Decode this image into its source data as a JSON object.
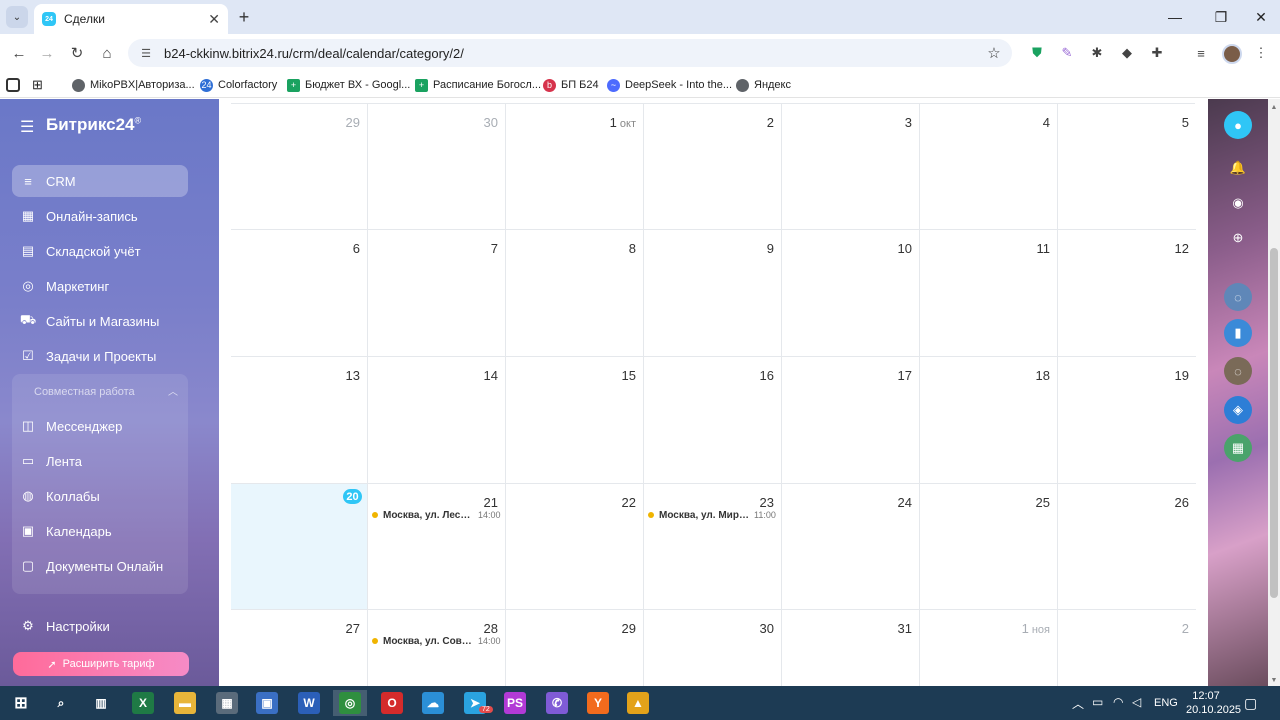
{
  "browser": {
    "tab": {
      "title": "Сделки",
      "favicon_text": "24"
    },
    "url": "b24-ckkinw.bitrix24.ru/crm/deal/calendar/category/2/",
    "bookmarks": [
      {
        "label": "MikoPBX|Авториза...",
        "icon": "globe-icon",
        "color": "#5f6368"
      },
      {
        "label": "Colorfactory",
        "icon": "bitrix-icon",
        "color": "#2f6fd6"
      },
      {
        "label": "Бюджет ВХ - Googl...",
        "icon": "sheets-icon",
        "color": "#1aa260"
      },
      {
        "label": "Расписание Богосл...",
        "icon": "sheets-icon",
        "color": "#1aa260"
      },
      {
        "label": "БП Б24",
        "icon": "bp-icon",
        "color": "#d6334c"
      },
      {
        "label": "DeepSeek - Into the...",
        "icon": "deepseek-icon",
        "color": "#4d6bfe"
      },
      {
        "label": "Яндекс",
        "icon": "globe-icon",
        "color": "#5f6368"
      }
    ]
  },
  "sidebar": {
    "logo": "Битрикс24",
    "logo_mark": "®",
    "items": [
      {
        "label": "CRM",
        "icon": "crm-filter-icon",
        "active": true
      },
      {
        "label": "Онлайн-запись",
        "icon": "booking-icon"
      },
      {
        "label": "Складской учёт",
        "icon": "warehouse-icon"
      },
      {
        "label": "Маркетинг",
        "icon": "marketing-icon"
      },
      {
        "label": "Сайты и Магазины",
        "icon": "cart-icon"
      },
      {
        "label": "Задачи и Проекты",
        "icon": "tasks-icon"
      }
    ],
    "group_title": "Совместная работа",
    "group_items": [
      {
        "label": "Мессенджер",
        "icon": "messenger-icon"
      },
      {
        "label": "Лента",
        "icon": "feed-icon"
      },
      {
        "label": "Коллабы",
        "icon": "collabs-icon"
      },
      {
        "label": "Календарь",
        "icon": "calendar-icon"
      },
      {
        "label": "Документы Онлайн",
        "icon": "documents-icon"
      }
    ],
    "settings_label": "Настройки",
    "upgrade_label": "Расширить тариф"
  },
  "calendar": {
    "weeks": [
      [
        {
          "day": "29",
          "muted": true
        },
        {
          "day": "30",
          "muted": true
        },
        {
          "day": "1",
          "month": "окт"
        },
        {
          "day": "2"
        },
        {
          "day": "3"
        },
        {
          "day": "4"
        },
        {
          "day": "5"
        }
      ],
      [
        {
          "day": "6"
        },
        {
          "day": "7"
        },
        {
          "day": "8"
        },
        {
          "day": "9"
        },
        {
          "day": "10"
        },
        {
          "day": "11"
        },
        {
          "day": "12"
        }
      ],
      [
        {
          "day": "13"
        },
        {
          "day": "14"
        },
        {
          "day": "15"
        },
        {
          "day": "16"
        },
        {
          "day": "17"
        },
        {
          "day": "18"
        },
        {
          "day": "19"
        }
      ],
      [
        {
          "day": "20",
          "today": true
        },
        {
          "day": "21",
          "event": {
            "title": "Москва, ул. Лесна...",
            "time": "14:00"
          }
        },
        {
          "day": "22"
        },
        {
          "day": "23",
          "event": {
            "title": "Москва, ул. Мира,...",
            "time": "11:00"
          }
        },
        {
          "day": "24"
        },
        {
          "day": "25"
        },
        {
          "day": "26"
        }
      ],
      [
        {
          "day": "27"
        },
        {
          "day": "28",
          "event": {
            "title": "Москва, ул. Совет...",
            "time": "14:00"
          }
        },
        {
          "day": "29"
        },
        {
          "day": "30"
        },
        {
          "day": "31"
        },
        {
          "day": "1",
          "month": "ноя",
          "muted": true
        },
        {
          "day": "2",
          "muted": true
        }
      ]
    ],
    "event_color": "#f0b400",
    "today_color": "#2fc6f6"
  },
  "taskbar": {
    "apps": [
      {
        "name": "search-app",
        "icon": "search-icon"
      },
      {
        "name": "task-view-app",
        "icon": "task-view-icon"
      },
      {
        "name": "excel-app",
        "icon": "excel-icon"
      },
      {
        "name": "explorer-app",
        "icon": "folder-icon"
      },
      {
        "name": "calculator-app",
        "icon": "calculator-icon"
      },
      {
        "name": "save-app",
        "icon": "floppy-icon"
      },
      {
        "name": "word-app",
        "icon": "word-icon"
      },
      {
        "name": "chrome-app",
        "icon": "chrome-icon",
        "active": true
      },
      {
        "name": "opera-app",
        "icon": "opera-icon"
      },
      {
        "name": "cloud-app",
        "icon": "cloud-icon"
      },
      {
        "name": "telegram-app",
        "icon": "telegram-icon",
        "badge": "72"
      },
      {
        "name": "phpstorm-app",
        "icon": "phpstorm-icon"
      },
      {
        "name": "viber-app",
        "icon": "viber-icon"
      },
      {
        "name": "yandex-app",
        "icon": "yandex-icon"
      },
      {
        "name": "photo-app",
        "icon": "photo-icon"
      }
    ],
    "lang": "ENG",
    "time": "12:07",
    "date": "20.10.2025"
  }
}
